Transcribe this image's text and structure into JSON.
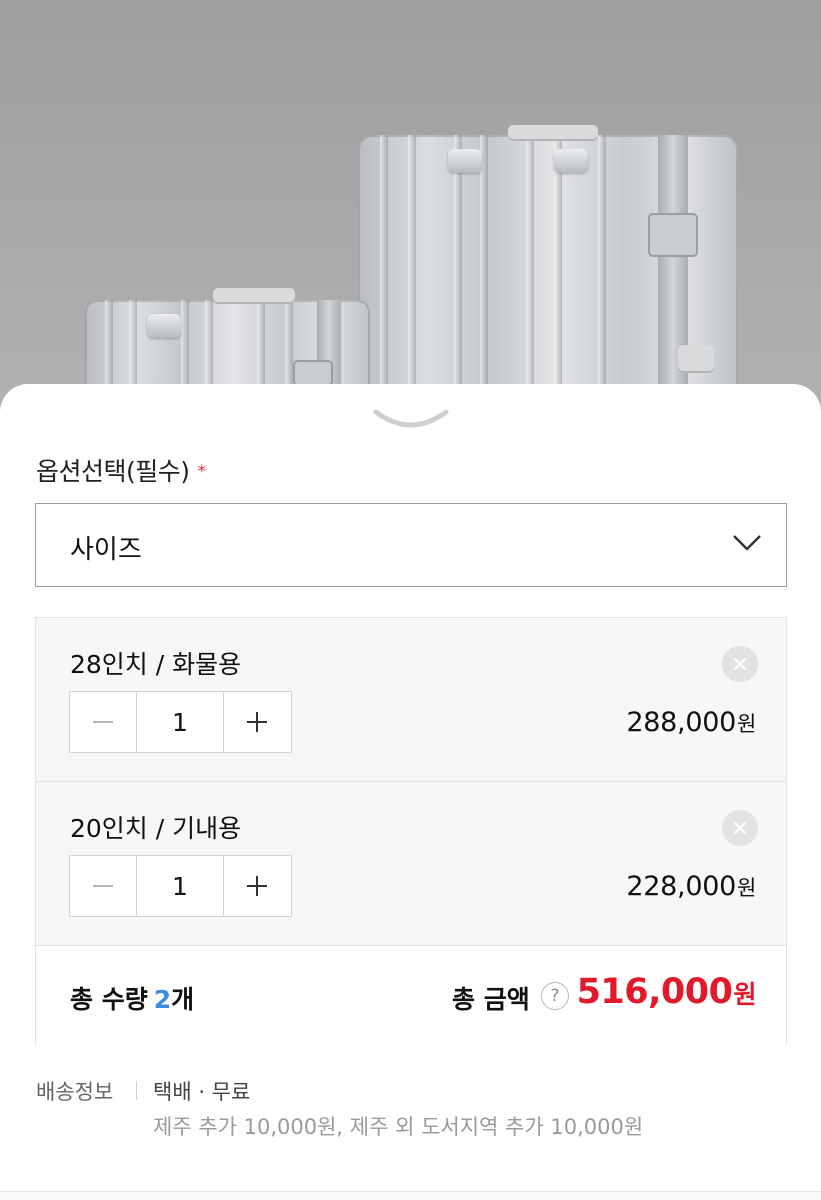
{
  "option": {
    "section_title": "옵션선택(필수)",
    "required_mark": "*",
    "select_label": "사이즈"
  },
  "items": [
    {
      "name": "28인치 / 화물용",
      "quantity": "1",
      "price": "288,000",
      "currency": "원"
    },
    {
      "name": "20인치 / 기내용",
      "quantity": "1",
      "price": "228,000",
      "currency": "원"
    }
  ],
  "summary": {
    "total_qty_label": "총 수량",
    "total_qty_value": "2",
    "total_qty_unit": "개",
    "total_amount_label": "총 금액",
    "help_symbol": "?",
    "total_amount": "516,000",
    "currency": "원"
  },
  "shipping": {
    "label": "배송정보",
    "method": "택배 · 무료",
    "note": "제주 추가 10,000원, 제주 외 도서지역 추가 10,000원"
  },
  "colors": {
    "accent_red": "#e0192b",
    "qty_blue": "#3d8ee0",
    "required_star": "#e4313c"
  },
  "icons": {
    "sheet_handle": "chevron-down-icon",
    "select_arrow": "chevron-down-icon",
    "remove": "close-icon",
    "decrement": "minus-icon",
    "increment": "plus-icon",
    "help": "question-icon"
  }
}
